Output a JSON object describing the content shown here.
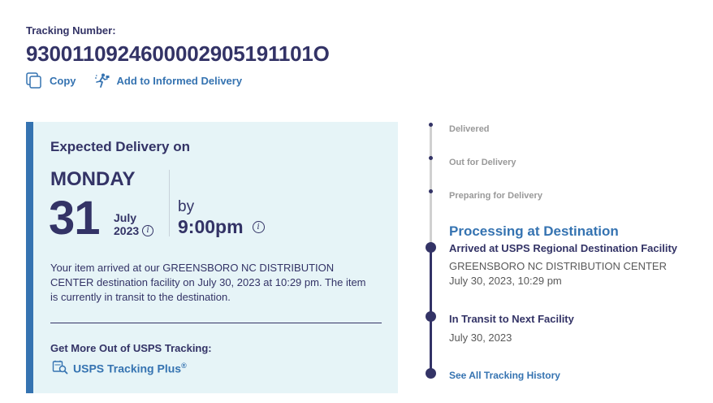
{
  "tracking": {
    "label": "Tracking Number:",
    "number": "9300110924600002905191101O"
  },
  "actions": {
    "copy_label": "Copy",
    "informed_label": "Add to Informed Delivery"
  },
  "expected": {
    "title": "Expected Delivery on",
    "day": "MONDAY",
    "date": "31",
    "month": "July",
    "year": "2023",
    "by": "by",
    "time": "9:00pm",
    "description": "Your item arrived at our GREENSBORO NC DISTRIBUTION CENTER destination facility on July 30, 2023 at 10:29 pm. The item is currently in transit to the destination.",
    "more_title": "Get More Out of USPS Tracking:",
    "plus_label": "USPS Tracking Plus",
    "plus_mark": "®"
  },
  "timeline": {
    "steps": [
      "Delivered",
      "Out for Delivery",
      "Preparing for Delivery"
    ],
    "current": "Processing at Destination",
    "events": [
      {
        "title": "Arrived at USPS Regional Destination Facility",
        "location": "GREENSBORO NC DISTRIBUTION CENTER",
        "date": "July 30, 2023, 10:29 pm"
      },
      {
        "title": "In Transit to Next Facility",
        "date": "July 30, 2023"
      }
    ],
    "history_link": "See All Tracking History"
  },
  "colors": {
    "navy": "#333366",
    "link_blue": "#3573b1",
    "card_bg": "#e6f4f7",
    "muted": "#999999"
  },
  "icons": [
    "copy-icon",
    "informed-delivery-icon",
    "info-icon",
    "tracking-plus-icon"
  ]
}
